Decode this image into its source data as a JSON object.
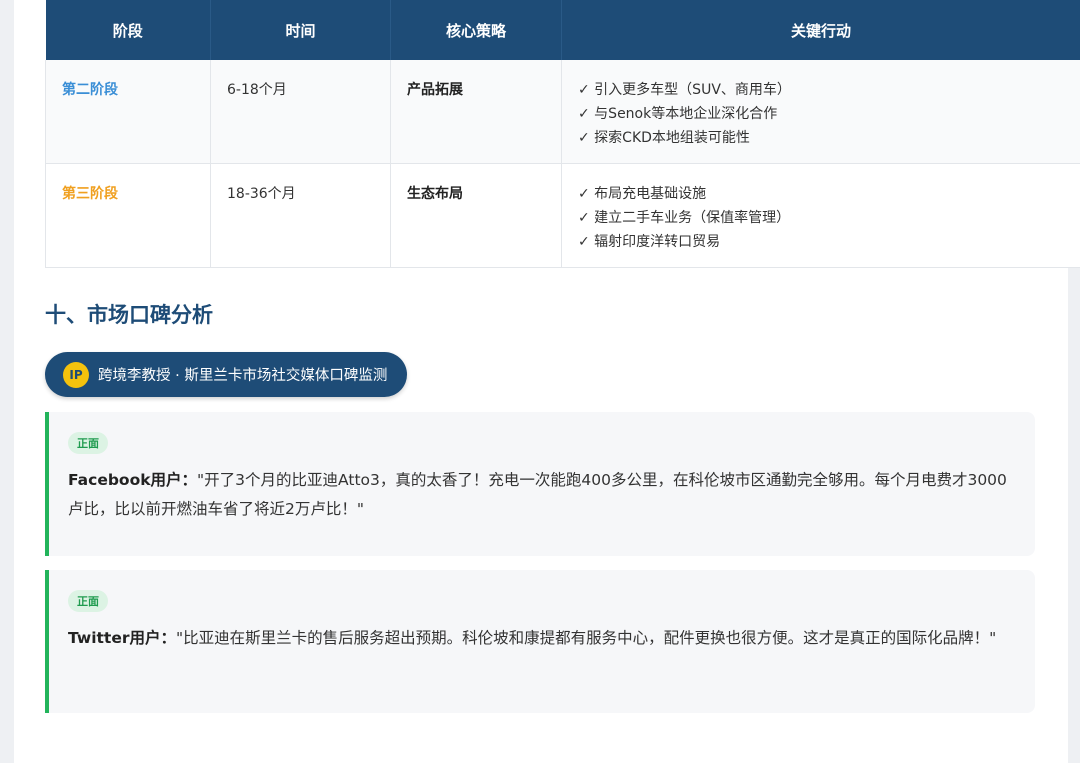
{
  "table": {
    "headers": [
      "阶段",
      "时间",
      "核心策略",
      "关键行动"
    ],
    "rows": [
      {
        "phase": "第二阶段",
        "phase_color": "#3a8ed6",
        "time": "6-18个月",
        "strategy": "产品拓展",
        "actions": [
          "✓ 引入更多车型（SUV、商用车）",
          "✓ 与Senok等本地企业深化合作",
          "✓ 探索CKD本地组装可能性"
        ]
      },
      {
        "phase": "第三阶段",
        "phase_color": "#f0a020",
        "time": "18-36个月",
        "strategy": "生态布局",
        "actions": [
          "✓ 布局充电基础设施",
          "✓ 建立二手车业务（保值率管理）",
          "✓ 辐射印度洋转口贸易"
        ]
      }
    ]
  },
  "section": {
    "title": "十、市场口碑分析"
  },
  "source_badge": {
    "icon_text": "IP",
    "label": "跨境李教授 · 斯里兰卡市场社交媒体口碑监测"
  },
  "reviews": [
    {
      "tag": "正面",
      "user": "Facebook用户：",
      "text": "\"开了3个月的比亚迪Atto3，真的太香了！充电一次能跑400多公里，在科伦坡市区通勤完全够用。每个月电费才3000卢比，比以前开燃油车省了将近2万卢比！\""
    },
    {
      "tag": "正面",
      "user": "Twitter用户：",
      "text": "\"比亚迪在斯里兰卡的售后服务超出预期。科伦坡和康提都有服务中心，配件更换也很方便。这才是真正的国际化品牌！\""
    }
  ],
  "colors": {
    "header_bg": "#1e4c77",
    "positive_accent": "#22b45b",
    "ip_icon_bg": "#f4c20d"
  }
}
